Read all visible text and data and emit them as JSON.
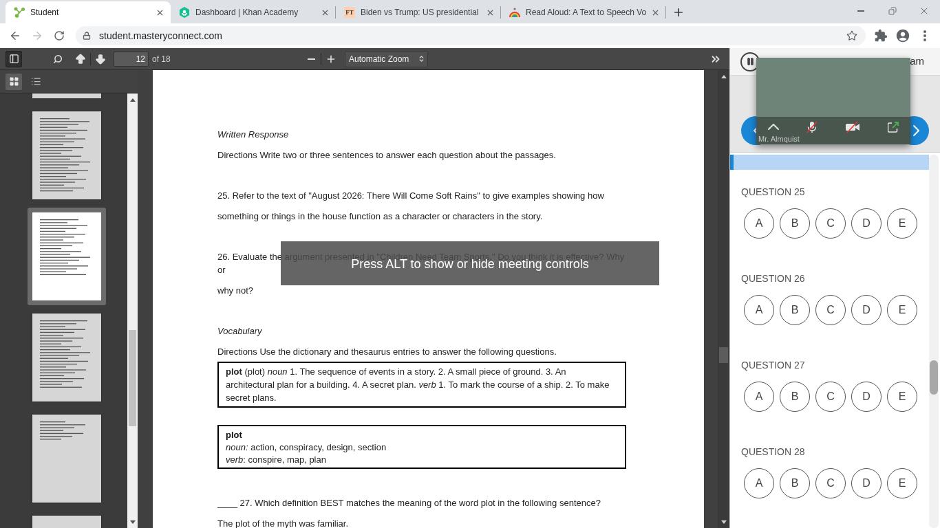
{
  "browser": {
    "tabs": [
      {
        "kind": "network",
        "title": "Student",
        "selected": true
      },
      {
        "kind": "hexagon",
        "title": "Dashboard | Khan Academy",
        "selected": false
      },
      {
        "kind": "letters",
        "icon_text": "FT",
        "title": "Biden vs Trump: US presidential",
        "selected": false
      },
      {
        "kind": "rainbow",
        "title": "Read Aloud: A Text to Speech Vo",
        "selected": false
      }
    ],
    "forward_disabled": true,
    "url": "student.masteryconnect.com"
  },
  "pdf_viewer": {
    "toolbar": {
      "sidebar_open": true,
      "page_number": "12",
      "page_count": "of 18",
      "zoom": "Automatic Zoom"
    },
    "sidebar": {
      "views": [
        {
          "kind": "thumbnails",
          "selected": true
        },
        {
          "kind": "outline",
          "selected": false
        }
      ],
      "thumbnails": [
        {
          "selected": false
        },
        {
          "selected": false
        },
        {
          "selected": true
        },
        {
          "selected": false
        },
        {
          "selected": false
        },
        {
          "selected": false
        }
      ]
    },
    "document": {
      "groups": [
        {
          "paragraphs": [
            {
              "kind": "heading",
              "lines": [
                "Written Response"
              ]
            },
            {
              "kind": "text",
              "lines": [
                "Directions Write two or three sentences to answer each question about the passages."
              ]
            }
          ]
        },
        {
          "paragraphs": [
            {
              "kind": "text",
              "lines": [
                "25. Refer to the text of \"August 2026: There Will Come Soft Rains\" to give examples showing how"
              ]
            },
            {
              "kind": "text",
              "lines": [
                "something or things in the house function as a character or characters in the story."
              ]
            }
          ]
        },
        {
          "paragraphs": [
            {
              "kind": "text",
              "lines": [
                "26. Evaluate the argument presented in \"Children Need Team Sports.\" Do you think it is effective? Why",
                "or"
              ]
            },
            {
              "kind": "text",
              "lines": [
                "why not?"
              ]
            }
          ]
        },
        {
          "paragraphs": [
            {
              "kind": "heading",
              "lines": [
                "Vocabulary"
              ]
            },
            {
              "kind": "text",
              "lines": [
                "Directions Use the dictionary and thesaurus entries to answer the following questions."
              ]
            },
            {
              "kind": "definition_box",
              "lines": [
                "**plot** (plot) *noun* 1. The sequence of events in a story. 2. A small piece of ground. 3. An architectural plan for a building. 4. A secret plan. *verb* 1. To mark the course of a ship. 2. To make secret plans."
              ]
            },
            {
              "kind": "thesaurus_box",
              "headword": "plot",
              "lines": [
                "*noun:* action, conspiracy, design, section",
                "*verb*: conspire, map, plan"
              ]
            }
          ]
        },
        {
          "paragraphs": [
            {
              "kind": "text",
              "lines": [
                "____ 27. Which definition BEST matches the meaning of the word plot in the following sentence?"
              ]
            },
            {
              "kind": "text",
              "lines": [
                "The plot of the myth was familiar."
              ]
            }
          ]
        }
      ]
    },
    "overlay": "Press ALT to show or hide meeting controls"
  },
  "meeting": {
    "participant": "Mr. Almquist",
    "mic_muted": true,
    "camera_off": true
  },
  "assessment": {
    "header_text": "am",
    "questions": [
      {
        "label": "QUESTION 25",
        "choices": [
          {
            "label": "A",
            "selected": false
          },
          {
            "label": "B",
            "selected": false
          },
          {
            "label": "C",
            "selected": false
          },
          {
            "label": "D",
            "selected": false
          },
          {
            "label": "E",
            "selected": false
          }
        ]
      },
      {
        "label": "QUESTION 26",
        "choices": [
          {
            "label": "A",
            "selected": false
          },
          {
            "label": "B",
            "selected": false
          },
          {
            "label": "C",
            "selected": false
          },
          {
            "label": "D",
            "selected": false
          },
          {
            "label": "E",
            "selected": false
          }
        ]
      },
      {
        "label": "QUESTION 27",
        "choices": [
          {
            "label": "A",
            "selected": false
          },
          {
            "label": "B",
            "selected": false
          },
          {
            "label": "C",
            "selected": false
          },
          {
            "label": "D",
            "selected": false
          },
          {
            "label": "E",
            "selected": false
          }
        ]
      },
      {
        "label": "QUESTION 28",
        "choices": [
          {
            "label": "A",
            "selected": false
          },
          {
            "label": "B",
            "selected": false
          },
          {
            "label": "C",
            "selected": false
          },
          {
            "label": "D",
            "selected": false
          },
          {
            "label": "E",
            "selected": false
          }
        ]
      }
    ]
  }
}
